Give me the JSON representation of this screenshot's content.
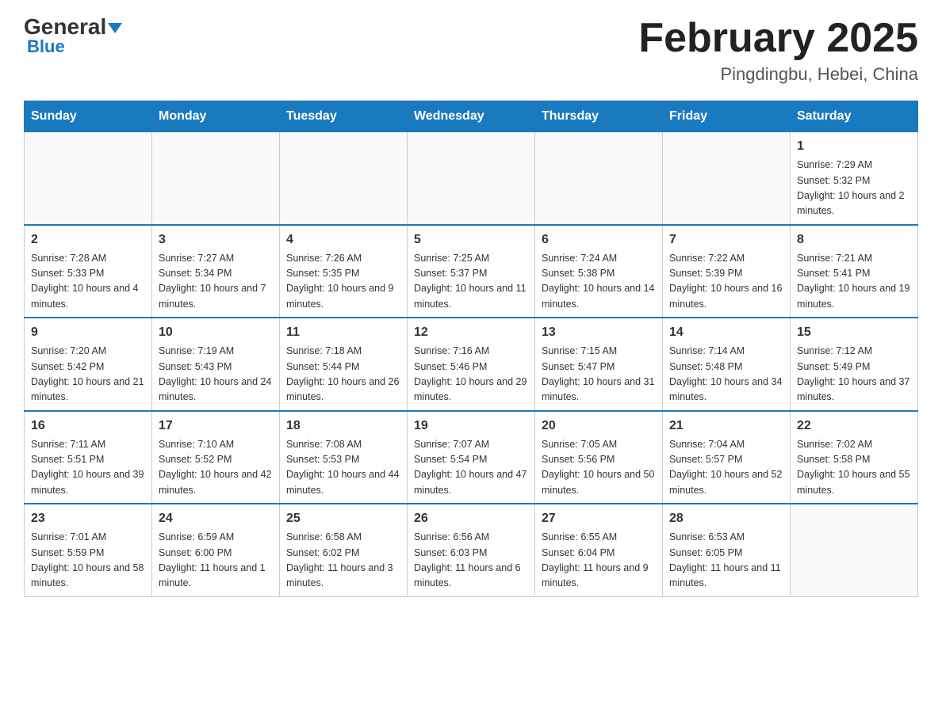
{
  "header": {
    "logo": {
      "general": "General",
      "arrow": "▼",
      "blue": "Blue"
    },
    "title": "February 2025",
    "location": "Pingdingbu, Hebei, China"
  },
  "days_of_week": [
    "Sunday",
    "Monday",
    "Tuesday",
    "Wednesday",
    "Thursday",
    "Friday",
    "Saturday"
  ],
  "weeks": [
    [
      {
        "day": "",
        "info": ""
      },
      {
        "day": "",
        "info": ""
      },
      {
        "day": "",
        "info": ""
      },
      {
        "day": "",
        "info": ""
      },
      {
        "day": "",
        "info": ""
      },
      {
        "day": "",
        "info": ""
      },
      {
        "day": "1",
        "info": "Sunrise: 7:29 AM\nSunset: 5:32 PM\nDaylight: 10 hours and 2 minutes."
      }
    ],
    [
      {
        "day": "2",
        "info": "Sunrise: 7:28 AM\nSunset: 5:33 PM\nDaylight: 10 hours and 4 minutes."
      },
      {
        "day": "3",
        "info": "Sunrise: 7:27 AM\nSunset: 5:34 PM\nDaylight: 10 hours and 7 minutes."
      },
      {
        "day": "4",
        "info": "Sunrise: 7:26 AM\nSunset: 5:35 PM\nDaylight: 10 hours and 9 minutes."
      },
      {
        "day": "5",
        "info": "Sunrise: 7:25 AM\nSunset: 5:37 PM\nDaylight: 10 hours and 11 minutes."
      },
      {
        "day": "6",
        "info": "Sunrise: 7:24 AM\nSunset: 5:38 PM\nDaylight: 10 hours and 14 minutes."
      },
      {
        "day": "7",
        "info": "Sunrise: 7:22 AM\nSunset: 5:39 PM\nDaylight: 10 hours and 16 minutes."
      },
      {
        "day": "8",
        "info": "Sunrise: 7:21 AM\nSunset: 5:41 PM\nDaylight: 10 hours and 19 minutes."
      }
    ],
    [
      {
        "day": "9",
        "info": "Sunrise: 7:20 AM\nSunset: 5:42 PM\nDaylight: 10 hours and 21 minutes."
      },
      {
        "day": "10",
        "info": "Sunrise: 7:19 AM\nSunset: 5:43 PM\nDaylight: 10 hours and 24 minutes."
      },
      {
        "day": "11",
        "info": "Sunrise: 7:18 AM\nSunset: 5:44 PM\nDaylight: 10 hours and 26 minutes."
      },
      {
        "day": "12",
        "info": "Sunrise: 7:16 AM\nSunset: 5:46 PM\nDaylight: 10 hours and 29 minutes."
      },
      {
        "day": "13",
        "info": "Sunrise: 7:15 AM\nSunset: 5:47 PM\nDaylight: 10 hours and 31 minutes."
      },
      {
        "day": "14",
        "info": "Sunrise: 7:14 AM\nSunset: 5:48 PM\nDaylight: 10 hours and 34 minutes."
      },
      {
        "day": "15",
        "info": "Sunrise: 7:12 AM\nSunset: 5:49 PM\nDaylight: 10 hours and 37 minutes."
      }
    ],
    [
      {
        "day": "16",
        "info": "Sunrise: 7:11 AM\nSunset: 5:51 PM\nDaylight: 10 hours and 39 minutes."
      },
      {
        "day": "17",
        "info": "Sunrise: 7:10 AM\nSunset: 5:52 PM\nDaylight: 10 hours and 42 minutes."
      },
      {
        "day": "18",
        "info": "Sunrise: 7:08 AM\nSunset: 5:53 PM\nDaylight: 10 hours and 44 minutes."
      },
      {
        "day": "19",
        "info": "Sunrise: 7:07 AM\nSunset: 5:54 PM\nDaylight: 10 hours and 47 minutes."
      },
      {
        "day": "20",
        "info": "Sunrise: 7:05 AM\nSunset: 5:56 PM\nDaylight: 10 hours and 50 minutes."
      },
      {
        "day": "21",
        "info": "Sunrise: 7:04 AM\nSunset: 5:57 PM\nDaylight: 10 hours and 52 minutes."
      },
      {
        "day": "22",
        "info": "Sunrise: 7:02 AM\nSunset: 5:58 PM\nDaylight: 10 hours and 55 minutes."
      }
    ],
    [
      {
        "day": "23",
        "info": "Sunrise: 7:01 AM\nSunset: 5:59 PM\nDaylight: 10 hours and 58 minutes."
      },
      {
        "day": "24",
        "info": "Sunrise: 6:59 AM\nSunset: 6:00 PM\nDaylight: 11 hours and 1 minute."
      },
      {
        "day": "25",
        "info": "Sunrise: 6:58 AM\nSunset: 6:02 PM\nDaylight: 11 hours and 3 minutes."
      },
      {
        "day": "26",
        "info": "Sunrise: 6:56 AM\nSunset: 6:03 PM\nDaylight: 11 hours and 6 minutes."
      },
      {
        "day": "27",
        "info": "Sunrise: 6:55 AM\nSunset: 6:04 PM\nDaylight: 11 hours and 9 minutes."
      },
      {
        "day": "28",
        "info": "Sunrise: 6:53 AM\nSunset: 6:05 PM\nDaylight: 11 hours and 11 minutes."
      },
      {
        "day": "",
        "info": ""
      }
    ]
  ]
}
